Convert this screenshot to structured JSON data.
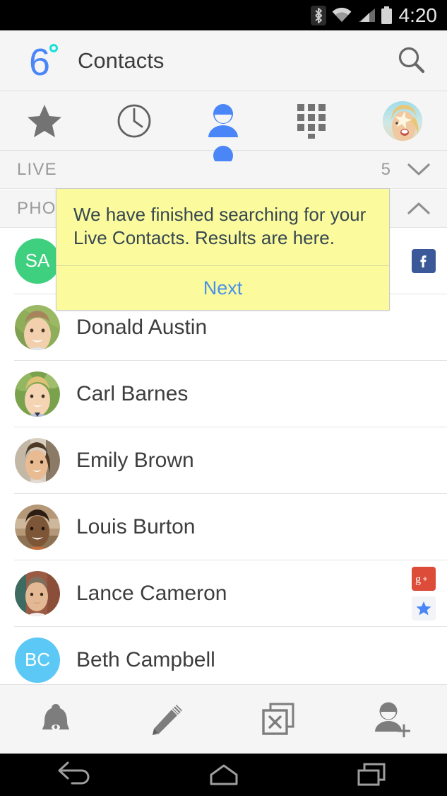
{
  "status_bar": {
    "time": "4:20",
    "icons": [
      "bluetooth-icon",
      "wifi-icon",
      "cellular-signal-icon",
      "battery-icon"
    ]
  },
  "app_bar": {
    "logo": "six-degrees-logo",
    "logo_text": "6",
    "title": "Contacts",
    "search_icon": "search-icon"
  },
  "tabs": [
    {
      "name": "favorites",
      "icon": "star-icon",
      "active": false
    },
    {
      "name": "recents",
      "icon": "clock-icon",
      "active": false
    },
    {
      "name": "contacts",
      "icon": "person-icon",
      "active": true
    },
    {
      "name": "dialpad",
      "icon": "dialpad-icon",
      "active": false
    },
    {
      "name": "profile",
      "icon": "user-avatar-photo",
      "active": false
    }
  ],
  "sections": [
    {
      "label": "LIVE",
      "count": "5",
      "chevron": "chevron-down-icon",
      "expanded": false
    },
    {
      "label": "PHONE",
      "count": "",
      "chevron": "chevron-up-icon",
      "expanded": true
    }
  ],
  "tooltip": {
    "message": "We have finished searching for your Live Contacts. Results are here.",
    "action_label": "Next",
    "background": "#fbfb9e",
    "action_color": "#4a90e8"
  },
  "contacts": [
    {
      "name": "",
      "avatar_type": "initials",
      "initials": "SA",
      "avatar_color": "#3ed07e",
      "badges": [
        "facebook-badge"
      ]
    },
    {
      "name": "Donald Austin",
      "avatar_type": "photo",
      "photo_desc": "man-smiling-green-background",
      "badges": []
    },
    {
      "name": "Carl Barnes",
      "avatar_type": "photo",
      "photo_desc": "blond-man-outdoors",
      "badges": []
    },
    {
      "name": "Emily Brown",
      "avatar_type": "photo",
      "photo_desc": "woman-smiling",
      "badges": []
    },
    {
      "name": "Louis Burton",
      "avatar_type": "photo",
      "photo_desc": "man-smiling-cafe",
      "badges": []
    },
    {
      "name": "Lance Cameron",
      "avatar_type": "photo",
      "photo_desc": "man-brick-wall",
      "badges": [
        "google-plus-badge",
        "star-badge"
      ]
    },
    {
      "name": "Beth Campbell",
      "avatar_type": "initials",
      "initials": "BC",
      "avatar_color": "#5bc8f5",
      "badges": []
    }
  ],
  "bottom_toolbar": [
    {
      "name": "notifications",
      "icon": "bell-icon"
    },
    {
      "name": "compose",
      "icon": "pencil-icon"
    },
    {
      "name": "duplicates",
      "icon": "duplicate-x-icon"
    },
    {
      "name": "add-contact",
      "icon": "person-add-icon"
    }
  ],
  "nav_bar": [
    {
      "name": "back",
      "icon": "back-arrow-icon"
    },
    {
      "name": "home",
      "icon": "home-icon"
    },
    {
      "name": "recents",
      "icon": "recents-icon"
    }
  ],
  "colors": {
    "accent_blue": "#4a86f7",
    "logo_dot": "#18e0d8",
    "facebook": "#3b5998",
    "google_plus": "#dd4b39",
    "star_blue": "#4a86f7",
    "chrome_bg": "#f5f5f5"
  }
}
